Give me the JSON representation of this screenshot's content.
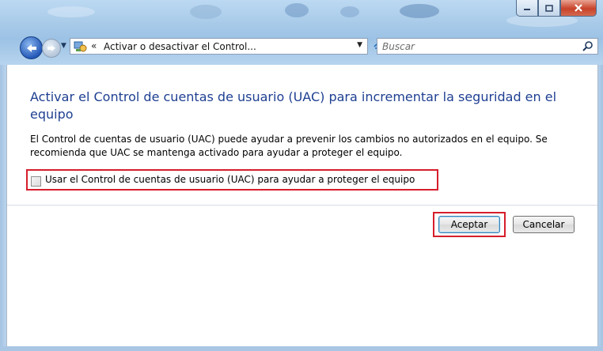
{
  "window": {
    "caption_buttons": [
      "minimize",
      "maximize",
      "close"
    ]
  },
  "toolbar": {
    "address_chevron": "«",
    "address_path": "Activar o desactivar el Control...",
    "search_placeholder": "Buscar"
  },
  "main": {
    "heading": "Activar el Control de cuentas de usuario (UAC) para incrementar la seguridad en el equipo",
    "description": "El Control de cuentas de usuario (UAC) puede ayudar a prevenir los cambios no autorizados en el equipo. Se recomienda que UAC se mantenga activado para ayudar a proteger el equipo.",
    "checkbox_label": "Usar el Control de cuentas de usuario (UAC) para ayudar a proteger el equipo",
    "checkbox_checked": false
  },
  "buttons": {
    "ok_label": "Aceptar",
    "cancel_label": "Cancelar"
  },
  "colors": {
    "heading": "#1e3f91",
    "highlight": "#d61e2b",
    "chrome": "#a9cbe9"
  }
}
